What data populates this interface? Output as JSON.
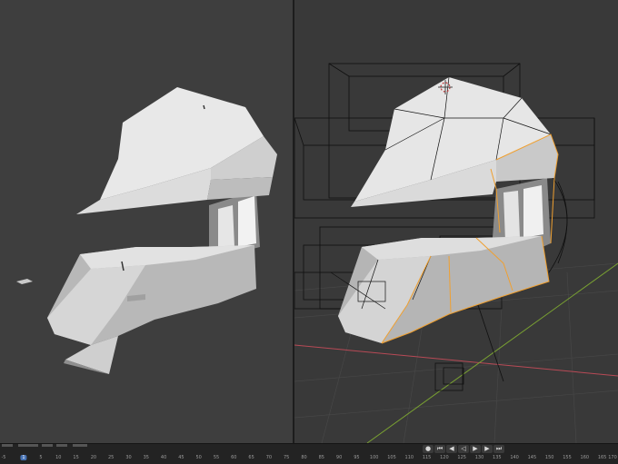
{
  "timeline": {
    "current_frame": "1",
    "ticks": [
      "-5",
      "5",
      "10",
      "15",
      "20",
      "25",
      "30",
      "35",
      "40",
      "45",
      "50",
      "55",
      "60",
      "65",
      "70",
      "75",
      "80",
      "85",
      "90",
      "95",
      "100",
      "105",
      "110",
      "115",
      "120",
      "125",
      "130",
      "135",
      "140",
      "145",
      "150",
      "155",
      "160",
      "165",
      "170"
    ],
    "playback": {
      "jump_start": "⏮",
      "prev_key": "◀",
      "play_reverse": "◁",
      "play": "▶",
      "next_key": "▶",
      "jump_end": "⏭",
      "record": "●"
    }
  },
  "viewports": {
    "left": {
      "shading": "solid",
      "object": "helmet"
    },
    "right": {
      "shading": "wireframe-overlay",
      "object": "helmet",
      "selection_color": "#f0a030"
    }
  },
  "colors": {
    "background": "#3e3e3e",
    "helmet_light": "#e4e4e4",
    "helmet_mid": "#bdbdbd",
    "helmet_dark": "#8e8e8e",
    "wire": "#111111",
    "x_axis": "#b84a56",
    "y_axis": "#7aa232",
    "selection": "#f0a030"
  }
}
